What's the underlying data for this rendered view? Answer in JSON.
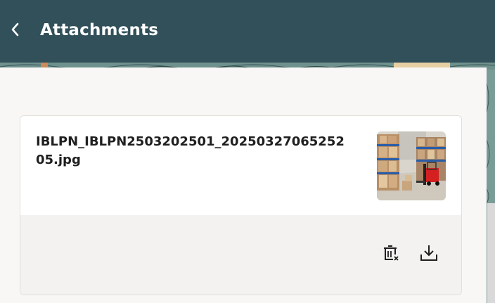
{
  "header": {
    "title": "Attachments",
    "back_icon": "chevron-left-icon",
    "background": "#31505a"
  },
  "attachments": [
    {
      "file_name": "IBLPN_IBLPN2503202501_2025032706525205.jpg",
      "thumbnail": "warehouse-forklift-photo",
      "actions": [
        {
          "icon": "delete-icon"
        },
        {
          "icon": "download-icon"
        }
      ]
    }
  ]
}
